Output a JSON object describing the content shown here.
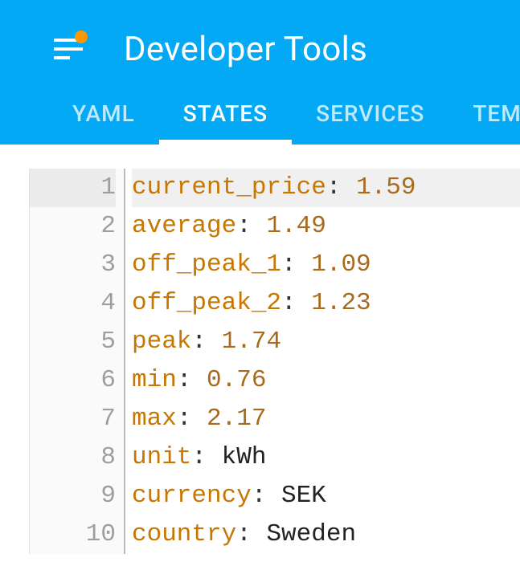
{
  "header": {
    "title": "Developer Tools"
  },
  "tabs": [
    {
      "label": "YAML",
      "active": false
    },
    {
      "label": "STATES",
      "active": true
    },
    {
      "label": "SERVICES",
      "active": false
    },
    {
      "label": "TEM",
      "active": false
    }
  ],
  "code": {
    "lines": [
      {
        "n": 1,
        "key": "current_price",
        "value": "1.59",
        "type": "num",
        "hl": true
      },
      {
        "n": 2,
        "key": "average",
        "value": "1.49",
        "type": "num",
        "hl": false
      },
      {
        "n": 3,
        "key": "off_peak_1",
        "value": "1.09",
        "type": "num",
        "hl": false
      },
      {
        "n": 4,
        "key": "off_peak_2",
        "value": "1.23",
        "type": "num",
        "hl": false
      },
      {
        "n": 5,
        "key": "peak",
        "value": "1.74",
        "type": "num",
        "hl": false
      },
      {
        "n": 6,
        "key": "min",
        "value": "0.76",
        "type": "num",
        "hl": false
      },
      {
        "n": 7,
        "key": "max",
        "value": "2.17",
        "type": "num",
        "hl": false
      },
      {
        "n": 8,
        "key": "unit",
        "value": "kWh",
        "type": "str",
        "hl": false
      },
      {
        "n": 9,
        "key": "currency",
        "value": "SEK",
        "type": "str",
        "hl": false
      },
      {
        "n": 10,
        "key": "country",
        "value": "Sweden",
        "type": "str",
        "hl": false
      }
    ]
  }
}
